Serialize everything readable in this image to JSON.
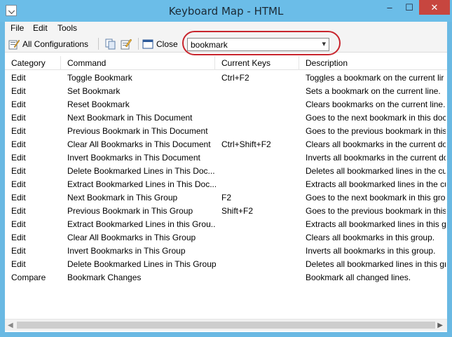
{
  "window": {
    "title": "Keyboard Map - HTML",
    "minimize": "–",
    "maximize": "☐",
    "close": "✕"
  },
  "menu": {
    "items": [
      "File",
      "Edit",
      "Tools"
    ]
  },
  "toolbar": {
    "all_configurations": "All Configurations",
    "close": "Close",
    "search_value": "bookmark"
  },
  "table": {
    "columns": [
      "Category",
      "Command",
      "Current Keys",
      "Description"
    ],
    "rows": [
      [
        "Edit",
        "Toggle Bookmark",
        "Ctrl+F2",
        "Toggles a bookmark on the current lir"
      ],
      [
        "Edit",
        "Set Bookmark",
        "",
        "Sets a bookmark on the current line."
      ],
      [
        "Edit",
        "Reset Bookmark",
        "",
        "Clears bookmarks on the current line."
      ],
      [
        "Edit",
        "Next Bookmark in This Document",
        "",
        "Goes to the next bookmark in this doc"
      ],
      [
        "Edit",
        "Previous  Bookmark in This Document",
        "",
        "Goes to the previous bookmark in this"
      ],
      [
        "Edit",
        "Clear All Bookmarks in This Document",
        "Ctrl+Shift+F2",
        "Clears all bookmarks in the current do"
      ],
      [
        "Edit",
        "Invert Bookmarks in This Document",
        "",
        "Inverts all bookmarks in the current do"
      ],
      [
        "Edit",
        "Delete Bookmarked Lines in This Doc...",
        "",
        "Deletes all bookmarked lines in the cu"
      ],
      [
        "Edit",
        "Extract Bookmarked Lines in This Doc...",
        "",
        "Extracts all bookmarked lines in the cu"
      ],
      [
        "Edit",
        "Next Bookmark in This Group",
        "F2",
        "Goes to the next bookmark in this gro"
      ],
      [
        "Edit",
        "Previous Bookmark in This Group",
        "Shift+F2",
        "Goes to the previous bookmark in this"
      ],
      [
        "Edit",
        "Extract Bookmarked Lines in this Grou...",
        "",
        "Extracts all bookmarked lines in this gr"
      ],
      [
        "Edit",
        "Clear All Bookmarks in This Group",
        "",
        "Clears all bookmarks in this group."
      ],
      [
        "Edit",
        "Invert Bookmarks in This Group",
        "",
        "Inverts all bookmarks in this group."
      ],
      [
        "Edit",
        "Delete Bookmarked Lines in This Group",
        "",
        "Deletes all bookmarked lines in this gr"
      ],
      [
        "Compare",
        "Bookmark Changes",
        "",
        "Bookmark all changed lines."
      ]
    ]
  },
  "scrollbar": {
    "left_arrow": "◀",
    "right_arrow": "▶"
  },
  "colors": {
    "title_bar": "#6bbde8",
    "close_button": "#c7463f",
    "highlight_ring": "#c8252d"
  }
}
